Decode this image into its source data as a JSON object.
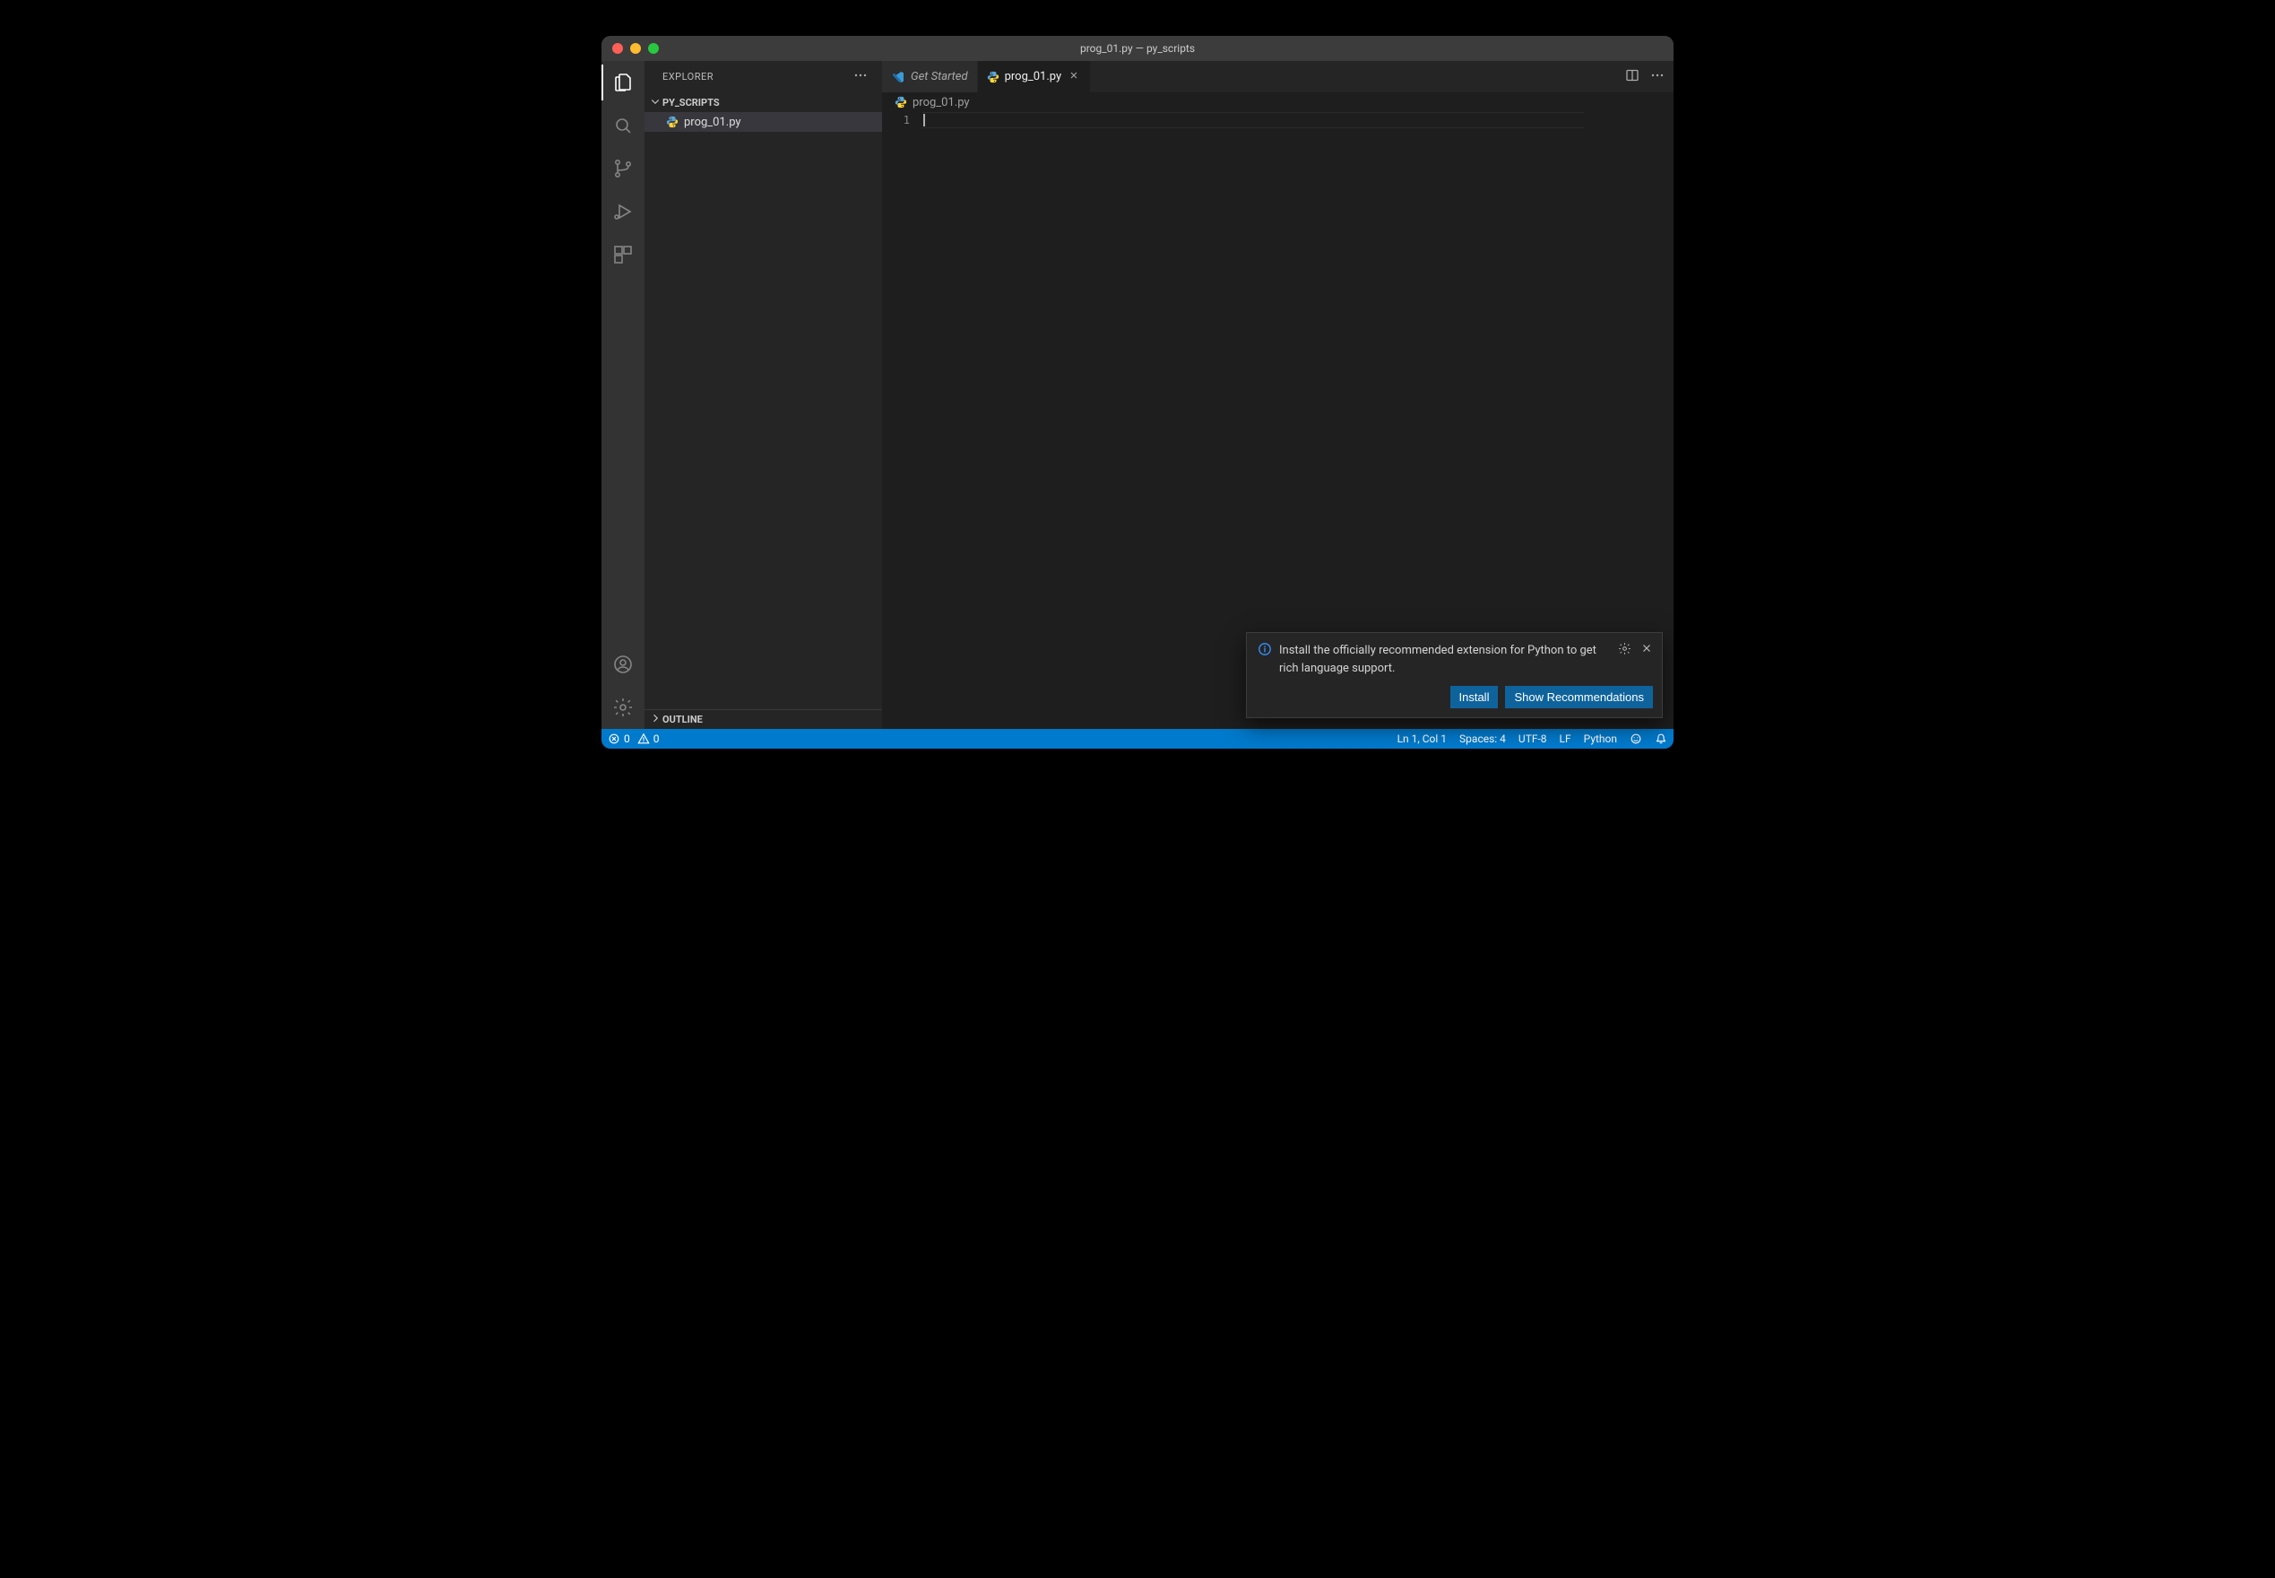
{
  "title": "prog_01.py — py_scripts",
  "sidebar": {
    "header": "EXPLORER",
    "folder": "PY_SCRIPTS",
    "outline": "OUTLINE",
    "files": [
      {
        "name": "prog_01.py"
      }
    ]
  },
  "tabs": [
    {
      "id": "get-started",
      "label": "Get Started",
      "kind": "welcome",
      "active": false
    },
    {
      "id": "prog-01",
      "label": "prog_01.py",
      "kind": "python",
      "active": true
    }
  ],
  "breadcrumb": "prog_01.py",
  "editor": {
    "line_numbers": [
      "1"
    ]
  },
  "toast": {
    "message": "Install the officially recommended extension for Python to get rich language support.",
    "install_label": "Install",
    "recommend_label": "Show Recommendations"
  },
  "status": {
    "errors": "0",
    "warnings": "0",
    "position": "Ln 1, Col 1",
    "indent": "Spaces: 4",
    "encoding": "UTF-8",
    "eol": "LF",
    "language": "Python"
  },
  "colors": {
    "statusbar": "#007acc"
  }
}
